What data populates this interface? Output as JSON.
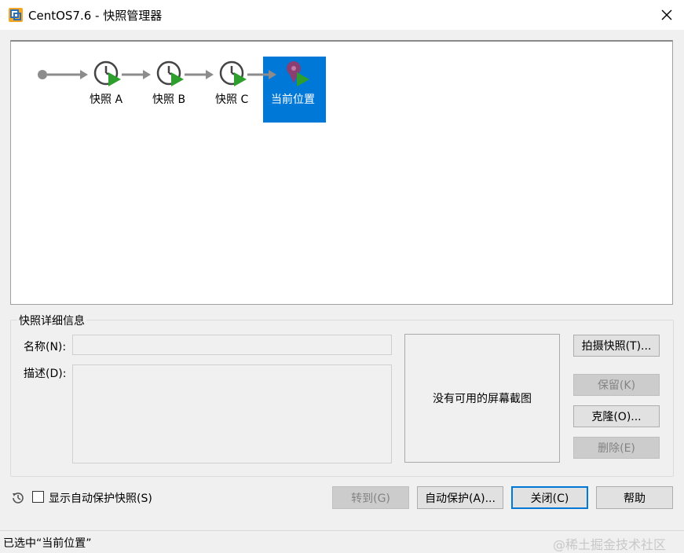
{
  "window": {
    "title": "CentOS7.6 - 快照管理器"
  },
  "snapshot_tree": {
    "nodes": [
      {
        "label": "快照 A",
        "icon": "snapshot-clock-icon"
      },
      {
        "label": "快照 B",
        "icon": "snapshot-clock-icon"
      },
      {
        "label": "快照 C",
        "icon": "snapshot-clock-icon"
      },
      {
        "label": "当前位置",
        "icon": "current-location-pin-icon",
        "selected": true
      }
    ]
  },
  "details": {
    "group_title": "快照详细信息",
    "name_label": "名称(N):",
    "name_value": "",
    "description_label": "描述(D):",
    "description_value": "",
    "screenshot_placeholder": "没有可用的屏幕截图"
  },
  "side_buttons": {
    "take_snapshot": "拍摄快照(T)...",
    "keep": "保留(K)",
    "clone": "克隆(O)...",
    "delete": "删除(E)"
  },
  "footer": {
    "show_autoprotect_label": "显示自动保护快照(S)",
    "show_autoprotect_checked": false,
    "goto": "转到(G)",
    "autoprotect": "自动保护(A)...",
    "close": "关闭(C)",
    "help": "帮助"
  },
  "status": {
    "text": "已选中“当前位置”",
    "watermark": "@稀土掘金技术社区"
  },
  "colors": {
    "selection": "#0078d7",
    "play_arrow": "#2e9e2e",
    "pin": "#7a3a6a"
  }
}
